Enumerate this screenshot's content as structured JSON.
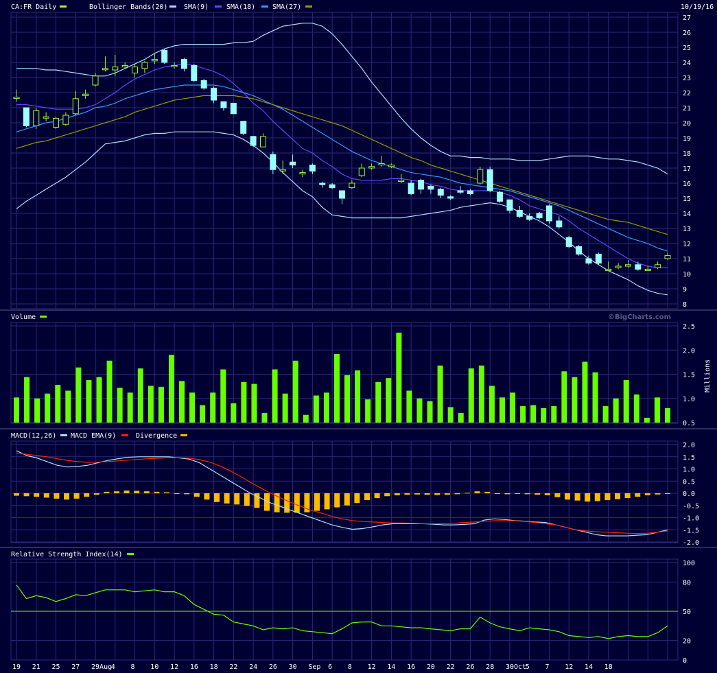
{
  "header": {
    "symbol_label": "CA:FR Daily",
    "date": "10/19/16",
    "indicators": [
      "Bollinger Bands(20)",
      "SMA(9)",
      "SMA(18)",
      "SMA(27)"
    ],
    "watermark": "©BigCharts.com"
  },
  "colors": {
    "background": "#000033",
    "grid": "#2a2a7a",
    "up_candle": "#99ff33",
    "down_candle": "#99ffff",
    "bollinger": "#aaddff",
    "sma9": "#6644ff",
    "sma18": "#3399ff",
    "sma27": "#999900",
    "volume": "#66ff00",
    "macd": "#aaddff",
    "macd_ema": "#ff2200",
    "divergence": "#ffbb00",
    "rsi": "#66ff00"
  },
  "chart_data": [
    {
      "type": "candlestick",
      "title": "CA:FR Daily",
      "ylim": [
        8,
        27
      ],
      "y_ticks": [
        8,
        9,
        10,
        11,
        12,
        13,
        14,
        15,
        16,
        17,
        18,
        19,
        20,
        21,
        22,
        23,
        24,
        25,
        26,
        27
      ],
      "x_tick_labels": [
        "19",
        "21",
        "25",
        "27",
        "29Aug",
        "4",
        "8",
        "10",
        "12",
        "16",
        "18",
        "22",
        "24",
        "26",
        "30",
        "Sep",
        "6",
        "8",
        "12",
        "14",
        "16",
        "20",
        "22",
        "26",
        "28",
        "30Oct",
        "5",
        "7",
        "12",
        "14",
        "18"
      ],
      "dates": [
        "7/19",
        "7/20",
        "7/21",
        "7/22",
        "7/25",
        "7/26",
        "7/27",
        "7/28",
        "7/29",
        "8/1",
        "8/2",
        "8/3",
        "8/4",
        "8/5",
        "8/8",
        "8/9",
        "8/10",
        "8/11",
        "8/12",
        "8/15",
        "8/16",
        "8/17",
        "8/18",
        "8/19",
        "8/22",
        "8/23",
        "8/24",
        "8/25",
        "8/26",
        "8/29",
        "8/30",
        "8/31",
        "9/1",
        "9/2",
        "9/5",
        "9/6",
        "9/7",
        "9/8",
        "9/9",
        "9/12",
        "9/13",
        "9/14",
        "9/15",
        "9/16",
        "9/19",
        "9/20",
        "9/21",
        "9/22",
        "9/23",
        "9/26",
        "9/27",
        "9/28",
        "9/29",
        "9/30",
        "10/3",
        "10/4",
        "10/5",
        "10/6",
        "10/7",
        "10/10",
        "10/11",
        "10/12",
        "10/13",
        "10/14",
        "10/17",
        "10/18",
        "10/19"
      ],
      "open": [
        21.7,
        21.0,
        19.8,
        20.4,
        19.7,
        19.9,
        20.6,
        21.8,
        22.5,
        23.6,
        23.5,
        23.7,
        23.3,
        23.6,
        24.1,
        24.8,
        23.8,
        24.2,
        23.8,
        22.8,
        22.3,
        21.4,
        21.3,
        20.1,
        19.1,
        18.4,
        17.9,
        16.9,
        17.4,
        16.7,
        17.2,
        16.0,
        15.9,
        15.5,
        15.7,
        16.5,
        17.0,
        17.3,
        17.1,
        16.2,
        16.0,
        16.2,
        15.8,
        15.6,
        15.1,
        15.5,
        15.5,
        16.0,
        16.9,
        15.4,
        14.9,
        14.2,
        13.8,
        14.0,
        14.5,
        13.5,
        12.4,
        11.8,
        11.0,
        11.3,
        10.3,
        10.4,
        10.5,
        10.6,
        10.3,
        10.4,
        11.0
      ],
      "close": [
        21.7,
        19.8,
        20.8,
        20.4,
        20.3,
        20.5,
        21.6,
        21.9,
        23.1,
        23.6,
        23.7,
        23.8,
        23.7,
        24.0,
        24.2,
        24.0,
        23.8,
        23.6,
        22.8,
        22.3,
        21.5,
        21.0,
        20.6,
        19.3,
        18.5,
        19.1,
        16.9,
        16.9,
        17.2,
        16.7,
        16.8,
        15.9,
        15.7,
        15.0,
        16.0,
        17.0,
        17.1,
        17.3,
        17.2,
        16.2,
        15.3,
        15.6,
        15.6,
        15.2,
        15.0,
        15.4,
        15.3,
        16.9,
        15.5,
        14.8,
        14.2,
        13.8,
        13.6,
        13.7,
        13.5,
        13.1,
        11.8,
        11.3,
        10.7,
        10.7,
        10.3,
        10.5,
        10.6,
        10.3,
        10.3,
        10.6,
        11.2
      ],
      "high": [
        22.2,
        21.0,
        21.0,
        20.7,
        20.4,
        20.7,
        22.1,
        22.2,
        23.3,
        24.4,
        24.5,
        24.0,
        23.9,
        24.1,
        24.6,
        24.9,
        24.0,
        24.3,
        23.9,
        22.9,
        22.4,
        21.4,
        21.3,
        20.1,
        19.1,
        19.3,
        18.1,
        17.5,
        17.9,
        16.9,
        17.3,
        16.1,
        16.0,
        15.5,
        16.2,
        17.3,
        17.3,
        17.8,
        17.3,
        16.6,
        16.2,
        16.3,
        15.9,
        15.7,
        15.2,
        15.8,
        15.6,
        17.1,
        17.1,
        15.5,
        14.9,
        14.5,
        14.0,
        14.1,
        14.6,
        13.8,
        12.5,
        11.9,
        11.2,
        11.4,
        10.8,
        10.7,
        10.9,
        10.8,
        10.5,
        10.8,
        11.4
      ],
      "low": [
        21.4,
        19.7,
        19.6,
        20.1,
        19.6,
        19.8,
        20.5,
        21.6,
        22.4,
        23.4,
        23.1,
        23.6,
        23.0,
        23.3,
        23.9,
        23.9,
        23.6,
        23.4,
        22.7,
        22.2,
        21.3,
        20.8,
        20.6,
        19.2,
        18.4,
        18.4,
        16.6,
        16.6,
        17.0,
        16.4,
        16.6,
        15.7,
        15.6,
        14.6,
        15.6,
        16.4,
        16.9,
        17.1,
        17.0,
        16.0,
        15.2,
        15.3,
        15.3,
        15.0,
        14.9,
        15.3,
        15.2,
        15.9,
        15.4,
        14.7,
        14.0,
        13.7,
        13.5,
        13.6,
        13.3,
        13.0,
        11.7,
        11.2,
        10.6,
        10.6,
        10.2,
        10.3,
        10.4,
        10.2,
        10.2,
        10.3,
        10.9
      ],
      "series": [
        {
          "name": "Bollinger Bands(20)",
          "key": "bb_upper",
          "values": [
            23.6,
            23.6,
            23.6,
            23.5,
            23.5,
            23.4,
            23.3,
            23.2,
            23.1,
            23.1,
            23.3,
            23.6,
            23.9,
            24.2,
            24.6,
            24.9,
            25.1,
            25.2,
            25.2,
            25.2,
            25.2,
            25.2,
            25.3,
            25.3,
            25.4,
            25.8,
            26.1,
            26.4,
            26.5,
            26.6,
            26.6,
            26.4,
            25.9,
            25.2,
            24.4,
            23.6,
            22.7,
            21.9,
            21.1,
            20.3,
            19.6,
            19.0,
            18.5,
            18.1,
            17.8,
            17.8,
            17.7,
            17.7,
            17.6,
            17.6,
            17.6,
            17.5,
            17.5,
            17.5,
            17.6,
            17.7,
            17.8,
            17.8,
            17.8,
            17.7,
            17.6,
            17.6,
            17.5,
            17.4,
            17.2,
            17.0,
            16.6
          ]
        },
        {
          "name": "Bollinger Bands(20) lower",
          "key": "bb_lower",
          "values": [
            14.3,
            14.8,
            15.2,
            15.6,
            16.0,
            16.4,
            16.9,
            17.4,
            18.0,
            18.6,
            18.7,
            18.8,
            19.0,
            19.2,
            19.3,
            19.3,
            19.4,
            19.4,
            19.4,
            19.4,
            19.4,
            19.3,
            19.2,
            18.9,
            18.5,
            18.0,
            17.4,
            16.7,
            16.1,
            15.5,
            15.1,
            14.4,
            13.9,
            13.8,
            13.7,
            13.7,
            13.7,
            13.7,
            13.7,
            13.7,
            13.8,
            13.9,
            14.0,
            14.1,
            14.2,
            14.4,
            14.5,
            14.6,
            14.7,
            14.6,
            14.4,
            14.1,
            13.8,
            13.5,
            13.1,
            12.6,
            12.1,
            11.5,
            11.0,
            10.6,
            10.2,
            9.9,
            9.6,
            9.2,
            8.9,
            8.7,
            8.6
          ]
        },
        {
          "name": "SMA(9)",
          "key": "sma9",
          "values": [
            21.2,
            21.2,
            21.1,
            21.0,
            20.9,
            20.9,
            20.9,
            21.0,
            21.2,
            21.6,
            22.0,
            22.5,
            22.9,
            23.2,
            23.5,
            23.7,
            23.8,
            23.9,
            23.8,
            23.6,
            23.4,
            23.1,
            22.6,
            22.0,
            21.3,
            20.8,
            20.1,
            19.5,
            18.9,
            18.3,
            18.0,
            17.5,
            17.1,
            16.6,
            16.3,
            16.2,
            16.2,
            16.2,
            16.3,
            16.3,
            16.2,
            16.1,
            15.9,
            15.8,
            15.6,
            15.5,
            15.5,
            15.5,
            15.5,
            15.4,
            15.2,
            14.9,
            14.5,
            14.3,
            14.1,
            13.9,
            13.5,
            13.0,
            12.6,
            12.2,
            11.8,
            11.4,
            11.0,
            10.7,
            10.5,
            10.4,
            10.4
          ]
        },
        {
          "name": "SMA(18)",
          "key": "sma18",
          "values": [
            19.4,
            19.6,
            19.8,
            20.0,
            20.1,
            20.3,
            20.5,
            20.7,
            21.0,
            21.1,
            21.3,
            21.6,
            21.8,
            22.0,
            22.2,
            22.3,
            22.4,
            22.5,
            22.5,
            22.5,
            22.5,
            22.4,
            22.2,
            22.0,
            21.8,
            21.5,
            21.2,
            20.9,
            20.5,
            20.1,
            19.7,
            19.3,
            18.9,
            18.5,
            18.1,
            17.8,
            17.5,
            17.3,
            17.1,
            16.9,
            16.7,
            16.6,
            16.5,
            16.4,
            16.2,
            16.0,
            15.9,
            15.8,
            15.7,
            15.6,
            15.5,
            15.3,
            15.1,
            14.9,
            14.7,
            14.5,
            14.2,
            13.9,
            13.6,
            13.3,
            13.0,
            12.7,
            12.4,
            12.2,
            12.0,
            11.7,
            11.5
          ]
        },
        {
          "name": "SMA(27)",
          "key": "sma27",
          "values": [
            18.3,
            18.5,
            18.7,
            18.8,
            19.0,
            19.2,
            19.4,
            19.6,
            19.8,
            20.0,
            20.2,
            20.4,
            20.7,
            20.9,
            21.1,
            21.3,
            21.5,
            21.6,
            21.7,
            21.8,
            21.8,
            21.8,
            21.8,
            21.7,
            21.6,
            21.4,
            21.2,
            21.0,
            20.8,
            20.6,
            20.4,
            20.2,
            20.0,
            19.8,
            19.5,
            19.2,
            18.9,
            18.6,
            18.3,
            18.0,
            17.7,
            17.5,
            17.2,
            17.0,
            16.8,
            16.6,
            16.4,
            16.2,
            16.0,
            15.8,
            15.6,
            15.4,
            15.2,
            15.0,
            14.8,
            14.6,
            14.4,
            14.2,
            14.0,
            13.8,
            13.6,
            13.5,
            13.4,
            13.2,
            13.0,
            12.8,
            12.6
          ]
        }
      ]
    },
    {
      "type": "bar",
      "title": "Volume",
      "ylabel": "Millions",
      "ylim": [
        0.5,
        2.5
      ],
      "y_ticks": [
        0.5,
        1.0,
        1.5,
        2.0,
        2.5
      ],
      "values": [
        1.02,
        1.44,
        1.0,
        1.1,
        1.28,
        1.16,
        1.64,
        1.38,
        1.44,
        1.78,
        1.22,
        1.12,
        1.62,
        1.26,
        1.24,
        1.9,
        1.36,
        1.12,
        0.86,
        1.12,
        1.6,
        0.9,
        1.34,
        1.3,
        0.7,
        1.6,
        1.1,
        1.78,
        0.66,
        1.06,
        1.12,
        1.92,
        1.48,
        1.58,
        0.98,
        1.34,
        1.42,
        2.36,
        1.16,
        1.0,
        0.94,
        1.68,
        0.82,
        0.7,
        1.62,
        1.68,
        1.26,
        1.02,
        1.12,
        0.84,
        0.86,
        0.8,
        0.84,
        1.56,
        1.44,
        1.76,
        1.54,
        0.84,
        1.0,
        1.38,
        1.08,
        0.6,
        1.02,
        0.8
      ]
    },
    {
      "type": "line",
      "title": "MACD(12,26)",
      "ylim": [
        -2.0,
        2.0
      ],
      "y_ticks": [
        2.0,
        1.5,
        1.0,
        0.5,
        0.0,
        -0.5,
        -1.0,
        -1.5,
        -2.0
      ],
      "series": [
        {
          "name": "MACD(12,26)",
          "key": "macd",
          "values": [
            1.75,
            1.55,
            1.45,
            1.3,
            1.15,
            1.08,
            1.1,
            1.15,
            1.25,
            1.35,
            1.42,
            1.48,
            1.5,
            1.5,
            1.5,
            1.5,
            1.45,
            1.4,
            1.25,
            1.0,
            0.75,
            0.5,
            0.25,
            0.0,
            -0.2,
            -0.4,
            -0.55,
            -0.7,
            -0.85,
            -1.0,
            -1.15,
            -1.3,
            -1.4,
            -1.48,
            -1.45,
            -1.38,
            -1.3,
            -1.25,
            -1.25,
            -1.25,
            -1.25,
            -1.27,
            -1.3,
            -1.3,
            -1.28,
            -1.25,
            -1.1,
            -1.05,
            -1.08,
            -1.12,
            -1.15,
            -1.18,
            -1.2,
            -1.3,
            -1.4,
            -1.5,
            -1.6,
            -1.7,
            -1.75,
            -1.75,
            -1.75,
            -1.72,
            -1.7,
            -1.6,
            -1.5
          ]
        },
        {
          "name": "MACD EMA(9)",
          "key": "macd_ema",
          "values": [
            1.65,
            1.6,
            1.55,
            1.5,
            1.42,
            1.35,
            1.3,
            1.27,
            1.28,
            1.3,
            1.33,
            1.36,
            1.39,
            1.42,
            1.44,
            1.46,
            1.46,
            1.44,
            1.38,
            1.28,
            1.12,
            0.92,
            0.7,
            0.45,
            0.22,
            0.0,
            -0.2,
            -0.38,
            -0.55,
            -0.7,
            -0.82,
            -0.95,
            -1.05,
            -1.12,
            -1.16,
            -1.18,
            -1.2,
            -1.22,
            -1.22,
            -1.23,
            -1.25,
            -1.25,
            -1.25,
            -1.23,
            -1.2,
            -1.18,
            -1.15,
            -1.13,
            -1.12,
            -1.13,
            -1.16,
            -1.2,
            -1.25,
            -1.3,
            -1.4,
            -1.5,
            -1.55,
            -1.58,
            -1.6,
            -1.62,
            -1.64,
            -1.65,
            -1.64,
            -1.6,
            -1.55
          ]
        },
        {
          "name": "Divergence",
          "key": "divergence",
          "values": [
            -0.1,
            -0.12,
            -0.14,
            -0.18,
            -0.22,
            -0.26,
            -0.22,
            -0.14,
            -0.06,
            0.06,
            0.08,
            0.11,
            0.1,
            0.08,
            0.06,
            0.04,
            0.0,
            -0.04,
            -0.14,
            -0.26,
            -0.36,
            -0.42,
            -0.46,
            -0.52,
            -0.6,
            -0.72,
            -0.78,
            -0.8,
            -0.8,
            -0.78,
            -0.72,
            -0.66,
            -0.58,
            -0.5,
            -0.4,
            -0.28,
            -0.2,
            -0.12,
            -0.08,
            -0.06,
            -0.05,
            -0.06,
            -0.07,
            -0.06,
            -0.04,
            0.02,
            0.08,
            0.06,
            0.0,
            -0.04,
            -0.03,
            -0.04,
            -0.06,
            -0.08,
            -0.16,
            -0.26,
            -0.3,
            -0.34,
            -0.32,
            -0.28,
            -0.24,
            -0.2,
            -0.14,
            -0.08,
            -0.05,
            0.0
          ]
        }
      ]
    },
    {
      "type": "line",
      "title": "Relative Strength Index(14)",
      "ylim": [
        0,
        100
      ],
      "y_ticks": [
        100,
        80,
        50,
        20,
        0
      ],
      "reference_line": 50,
      "series": [
        {
          "name": "Relative Strength Index(14)",
          "key": "rsi",
          "values": [
            77,
            63,
            66,
            64,
            60,
            63,
            67,
            66,
            69,
            72,
            72,
            72,
            70,
            71,
            72,
            70,
            70,
            66,
            57,
            52,
            47,
            46,
            39,
            37,
            35,
            31,
            33,
            32,
            33,
            30,
            29,
            28,
            27,
            32,
            38,
            39,
            39,
            35,
            35,
            34,
            33,
            33,
            32,
            31,
            30,
            32,
            32,
            44,
            38,
            34,
            32,
            30,
            33,
            32,
            31,
            29,
            25,
            24,
            23,
            24,
            22,
            24,
            25,
            24,
            24,
            28,
            35
          ]
        }
      ]
    }
  ]
}
